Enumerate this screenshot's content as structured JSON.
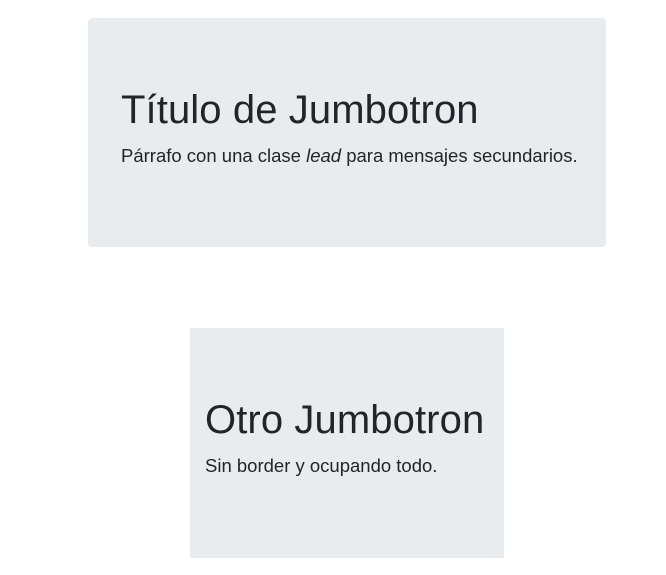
{
  "jumbotron_primary": {
    "title": "Título de Jumbotron",
    "lead_before": "Párrafo con una clase ",
    "lead_emphasis": "lead",
    "lead_after": " para mensajes secundarios."
  },
  "jumbotron_secondary": {
    "title": "Otro Jumbotron",
    "lead": "Sin border y ocupando todo."
  },
  "colors": {
    "jumbotron_background": "#e9ecef",
    "text": "#212529",
    "page_background": "#ffffff"
  }
}
